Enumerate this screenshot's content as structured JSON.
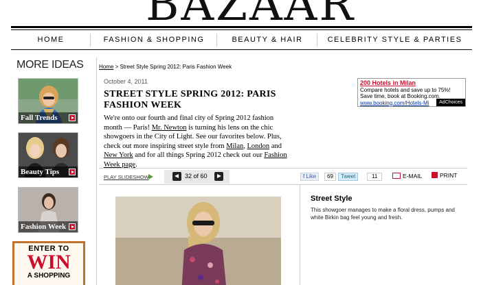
{
  "masthead": {
    "logo": "BAZAAR"
  },
  "nav": {
    "items": [
      "HOME",
      "FASHION & SHOPPING",
      "BEAUTY & HAIR",
      "CELEBRITY STYLE & PARTIES"
    ]
  },
  "sidebar": {
    "title": "MORE IDEAS",
    "promos": [
      {
        "label": "Fall Trends"
      },
      {
        "label": "Beauty Tips"
      },
      {
        "label": "Fashion Week"
      }
    ],
    "contest": {
      "line1": "ENTER TO",
      "line2": "WIN",
      "line3": "A SHOPPING"
    }
  },
  "breadcrumb": {
    "home": "Home",
    "rest": " > Street Style Spring 2012: Paris Fashion Week"
  },
  "article": {
    "date": "October 4, 2011",
    "headline": "STREET STYLE SPRING 2012: PARIS FASHION WEEK",
    "p_1": "We're onto our fourth and final city of Spring 2012 fashion month — Paris! ",
    "link_newton": "Mr. Newton",
    "p_2": " is turning his lens on the chic showgoers in the City of Light. See our favorites below. Plus, check out more inspiring street style from ",
    "link_milan": "Milan",
    "p_3": ", ",
    "link_london": "London",
    "p_4": " and ",
    "link_newyork": "New York",
    "p_5": " and for all things Spring 2012 check out our ",
    "link_fw": "Fashion Week page",
    "p_6": "."
  },
  "ad": {
    "title": "200 Hotels in Milan",
    "line1": "Compare hotels and save up to 75%!",
    "line2": "Save time, book at Booking.com.",
    "url": "www.booking.com/Hotels-Mi",
    "choices": "AdChoices"
  },
  "toolbar": {
    "play": "PLAY SLIDESHOW",
    "counter": "32 of 60",
    "fb_label": "Like",
    "fb_count": "69",
    "tw_label": "Tweet",
    "tw_count": "11",
    "email": "E-MAIL",
    "print": "PRINT"
  },
  "slide": {
    "title": "Street Style",
    "caption": "This showgoer manages to make a floral dress, pumps and white Birkin bag feel young and fresh."
  },
  "colors": {
    "accent": "#c8102e",
    "fb": "#3b5998",
    "twitter": "#186487"
  }
}
